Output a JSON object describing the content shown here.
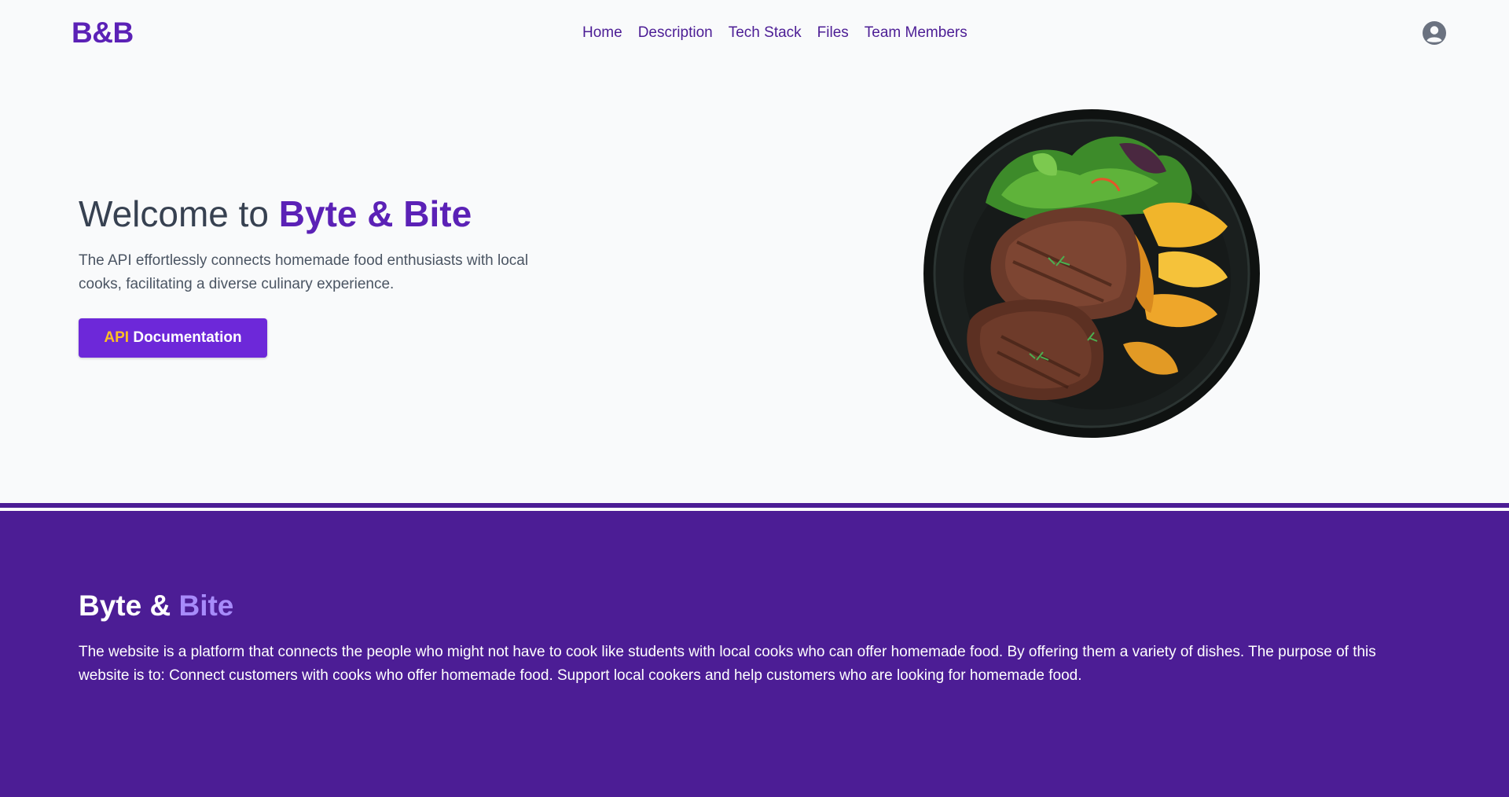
{
  "navbar": {
    "logo": "B&B",
    "links": [
      "Home",
      "Description",
      "Tech Stack",
      "Files",
      "Team Members"
    ],
    "avatar_icon": "user-circle-icon"
  },
  "hero": {
    "title_prefix": "Welcome to ",
    "title_brand": "Byte & Bite",
    "description": "The API effortlessly connects homemade food enthusiasts with local cooks, facilitating a diverse culinary experience.",
    "button_accent": "API",
    "button_rest": " Documentation",
    "image_icon": "food-plate-image"
  },
  "about": {
    "title_prefix": "Byte & ",
    "title_accent": "Bite",
    "text": "The website is a platform that connects the people who might not have to cook like students with local cooks who can offer homemade food. By offering them a variety of dishes. The purpose of this website is to: Connect customers with cooks who offer homemade food. Support local cookers and help customers who are looking for homemade food."
  },
  "colors": {
    "brand": "#5b21b6",
    "button": "#6d28d9",
    "button_accent": "#fbbf24",
    "about_bg": "#4c1d95",
    "about_accent": "#a78bfa"
  }
}
